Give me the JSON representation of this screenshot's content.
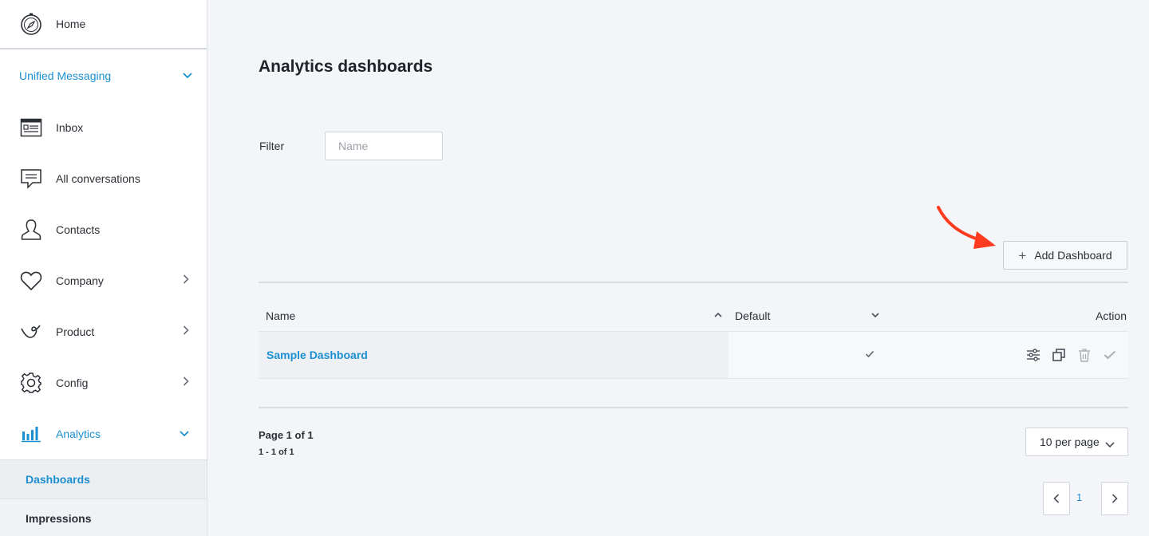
{
  "sidebar": {
    "home": {
      "label": "Home",
      "icon": "compass-icon"
    },
    "section": {
      "label": "Unified Messaging",
      "icon": "chevron-down-icon"
    },
    "items": [
      {
        "label": "Inbox",
        "icon": "inbox-icon"
      },
      {
        "label": "All conversations",
        "icon": "chat-icon"
      },
      {
        "label": "Contacts",
        "icon": "person-icon"
      },
      {
        "label": "Company",
        "icon": "heart-icon"
      },
      {
        "label": "Product",
        "icon": "product-icon"
      },
      {
        "label": "Config",
        "icon": "gear-icon"
      },
      {
        "label": "Analytics",
        "icon": "bar-chart-icon"
      }
    ],
    "sub_items": [
      {
        "label": "Dashboards"
      },
      {
        "label": "Impressions"
      }
    ]
  },
  "main": {
    "title": "Analytics dashboards",
    "filter": {
      "label": "Filter",
      "placeholder": "Name"
    },
    "add_button": "Add Dashboard",
    "table": {
      "headers": {
        "name": "Name",
        "default": "Default",
        "action": "Action"
      },
      "rows": [
        {
          "name": "Sample Dashboard",
          "default": true
        }
      ]
    },
    "pagination": {
      "page_info": "Page 1 of 1",
      "range": "1 - 1 of 1",
      "per_page": "10 per page",
      "current_page": "1"
    }
  },
  "colors": {
    "accent": "#1b8fd0",
    "background": "#f4f5f9",
    "arrow": "#ff3b1f"
  }
}
